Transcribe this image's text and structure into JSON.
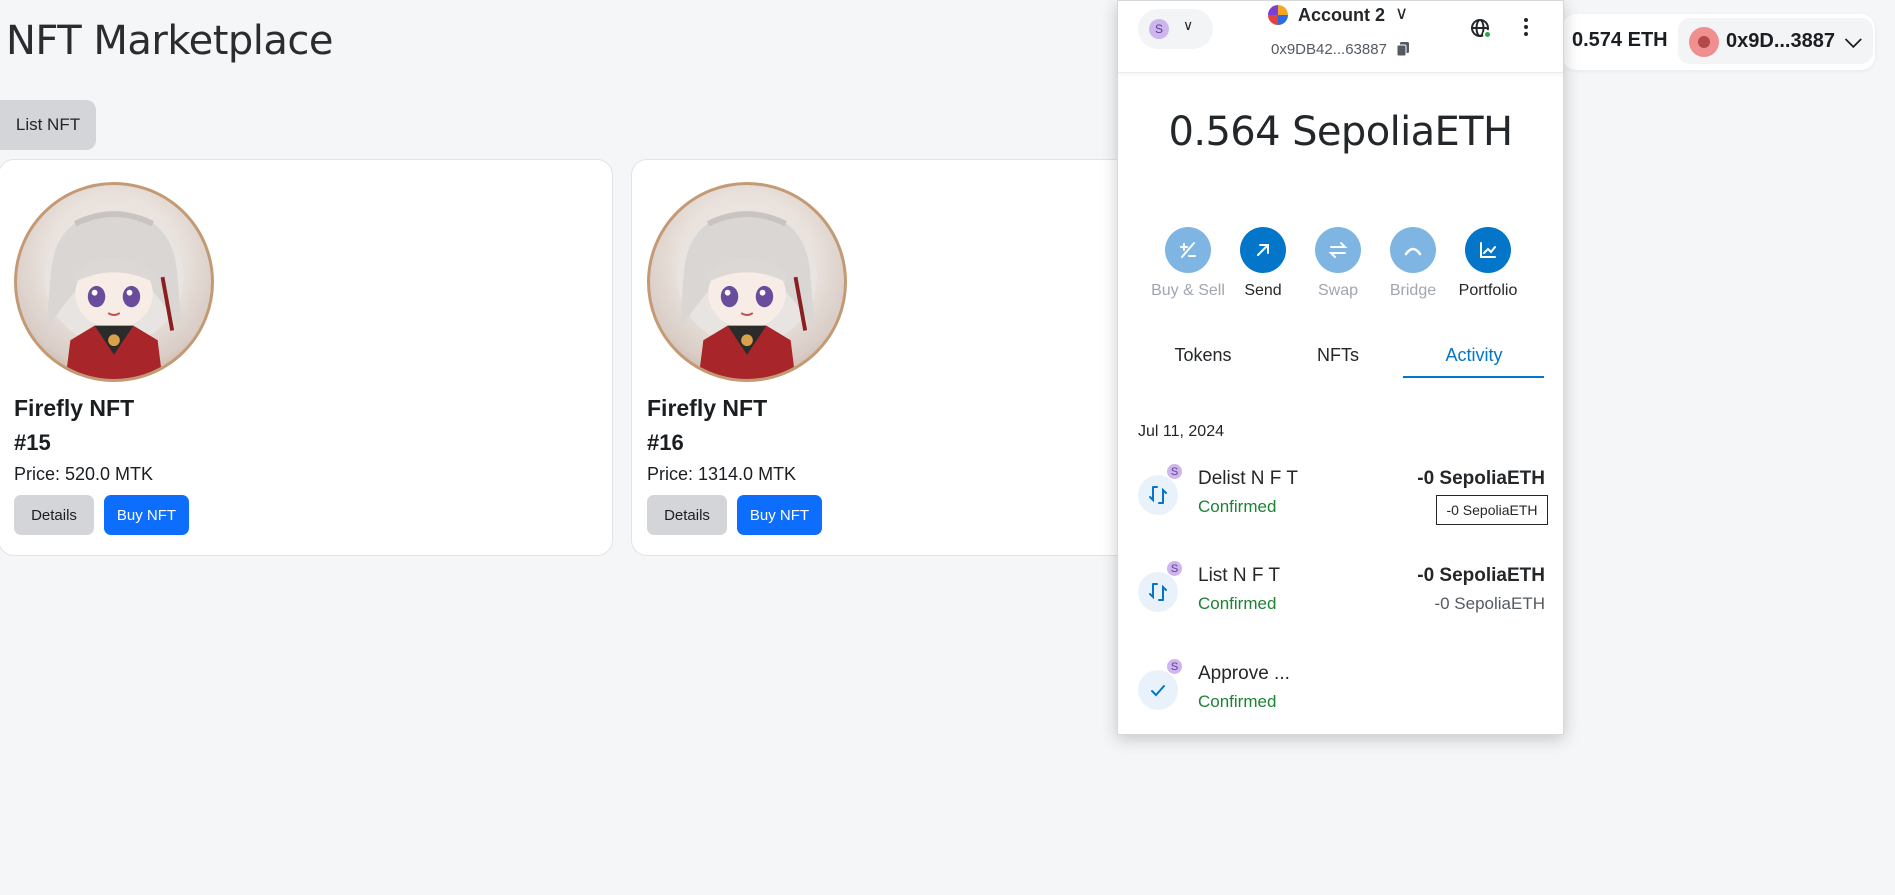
{
  "page": {
    "title": "NFT Marketplace",
    "list_button": "List NFT"
  },
  "cards": [
    {
      "name": "Firefly NFT",
      "id": "#15",
      "price": "Price: 520.0 MTK",
      "details": "Details",
      "buy": "Buy NFT"
    },
    {
      "name": "Firefly NFT",
      "id": "#16",
      "price": "Price: 1314.0 MTK",
      "details": "Details",
      "buy": "Buy NFT"
    }
  ],
  "header": {
    "balance": "0.574 ETH",
    "address": "0x9D...3887"
  },
  "wallet": {
    "network_badge": "S",
    "account_name": "Account 2",
    "account_address": "0x9DB42...63887",
    "balance": "0.564 SepoliaETH",
    "actions": [
      {
        "label": "Buy & Sell",
        "icon": "plus-minus-icon",
        "enabled": false
      },
      {
        "label": "Send",
        "icon": "arrow-up-right-icon",
        "enabled": true
      },
      {
        "label": "Swap",
        "icon": "swap-icon",
        "enabled": false
      },
      {
        "label": "Bridge",
        "icon": "bridge-icon",
        "enabled": false
      },
      {
        "label": "Portfolio",
        "icon": "chart-icon",
        "enabled": true
      }
    ],
    "tabs": [
      "Tokens",
      "NFTs",
      "Activity"
    ],
    "active_tab": "Activity",
    "activity_date": "Jul 11, 2024",
    "transactions": [
      {
        "title": "Delist N F T",
        "status": "Confirmed",
        "amount": "-0 SepoliaETH",
        "sub": "-",
        "icon": "contract-interaction-icon"
      },
      {
        "title": "List N F T",
        "status": "Confirmed",
        "amount": "-0 SepoliaETH",
        "sub": "-0 SepoliaETH",
        "icon": "contract-interaction-icon"
      },
      {
        "title": "Approve ...",
        "status": "Confirmed",
        "amount": "",
        "sub": "",
        "icon": "check-icon"
      }
    ],
    "tooltip": "-0 SepoliaETH",
    "colors": {
      "accent": "#0376c9",
      "success": "#1c8234",
      "buy_button": "#0d6efd"
    }
  }
}
